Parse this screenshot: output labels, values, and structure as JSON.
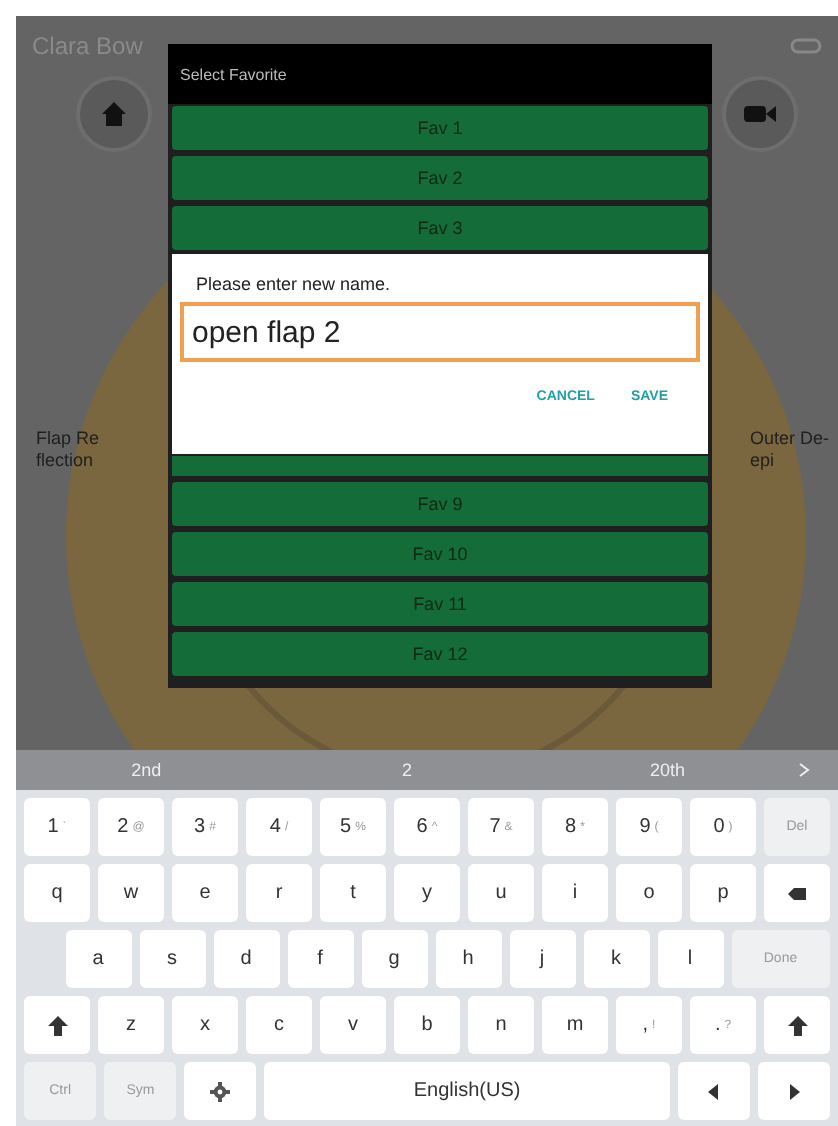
{
  "app": {
    "title": "Clara Bow",
    "left_label": "Flap Re flection",
    "right_label": "Outer De-epi"
  },
  "favorites_dialog": {
    "title": "Select Favorite",
    "rows_above": [
      {
        "label": "Fav 1"
      },
      {
        "label": "Fav 2"
      },
      {
        "label": "Fav 3"
      }
    ],
    "rows_below": [
      {
        "label": "Fav 9"
      },
      {
        "label": "Fav 10"
      },
      {
        "label": "Fav 11"
      },
      {
        "label": "Fav 12"
      }
    ]
  },
  "rename_dialog": {
    "prompt": "Please enter new name.",
    "value": "open flap 2",
    "buttons": [
      "CANCEL",
      "SAVE"
    ]
  },
  "keyboard": {
    "suggestions": [
      "2nd",
      "2",
      "20th"
    ],
    "rows": [
      [
        {
          "kind": "char",
          "label": "1",
          "hint": "`"
        },
        {
          "kind": "char",
          "label": "2",
          "hint": "@"
        },
        {
          "kind": "char",
          "label": "3",
          "hint": "#"
        },
        {
          "kind": "char",
          "label": "4",
          "hint": "/"
        },
        {
          "kind": "char",
          "label": "5",
          "hint": "%"
        },
        {
          "kind": "char",
          "label": "6",
          "hint": "^"
        },
        {
          "kind": "char",
          "label": "7",
          "hint": "&"
        },
        {
          "kind": "char",
          "label": "8",
          "hint": "*"
        },
        {
          "kind": "char",
          "label": "9",
          "hint": "("
        },
        {
          "kind": "char",
          "label": "0",
          "hint": ")"
        },
        {
          "kind": "func",
          "label": "Del"
        }
      ],
      [
        {
          "kind": "char",
          "label": "q"
        },
        {
          "kind": "char",
          "label": "w"
        },
        {
          "kind": "char",
          "label": "e"
        },
        {
          "kind": "char",
          "label": "r"
        },
        {
          "kind": "char",
          "label": "t"
        },
        {
          "kind": "char",
          "label": "y"
        },
        {
          "kind": "char",
          "label": "u"
        },
        {
          "kind": "char",
          "label": "i"
        },
        {
          "kind": "char",
          "label": "o"
        },
        {
          "kind": "char",
          "label": "p"
        },
        {
          "kind": "backspace"
        }
      ],
      [
        {
          "kind": "spacer"
        },
        {
          "kind": "char",
          "label": "a"
        },
        {
          "kind": "char",
          "label": "s"
        },
        {
          "kind": "char",
          "label": "d"
        },
        {
          "kind": "char",
          "label": "f"
        },
        {
          "kind": "char",
          "label": "g"
        },
        {
          "kind": "char",
          "label": "h"
        },
        {
          "kind": "char",
          "label": "j"
        },
        {
          "kind": "char",
          "label": "k"
        },
        {
          "kind": "char",
          "label": "l"
        },
        {
          "kind": "done",
          "label": "Done"
        }
      ],
      [
        {
          "kind": "shift"
        },
        {
          "kind": "char",
          "label": "z"
        },
        {
          "kind": "char",
          "label": "x"
        },
        {
          "kind": "char",
          "label": "c"
        },
        {
          "kind": "char",
          "label": "v"
        },
        {
          "kind": "char",
          "label": "b"
        },
        {
          "kind": "char",
          "label": "n"
        },
        {
          "kind": "char",
          "label": "m"
        },
        {
          "kind": "char",
          "label": ",",
          "hint": "!"
        },
        {
          "kind": "char",
          "label": ".",
          "hint": "?"
        },
        {
          "kind": "shift"
        }
      ]
    ],
    "bottom_row": {
      "left_keys": [
        {
          "kind": "func",
          "label": "Ctrl"
        },
        {
          "kind": "func",
          "label": "Sym"
        },
        {
          "kind": "gear"
        }
      ],
      "space_label": "English(US)",
      "right_keys": [
        {
          "kind": "left"
        },
        {
          "kind": "right"
        }
      ]
    }
  }
}
